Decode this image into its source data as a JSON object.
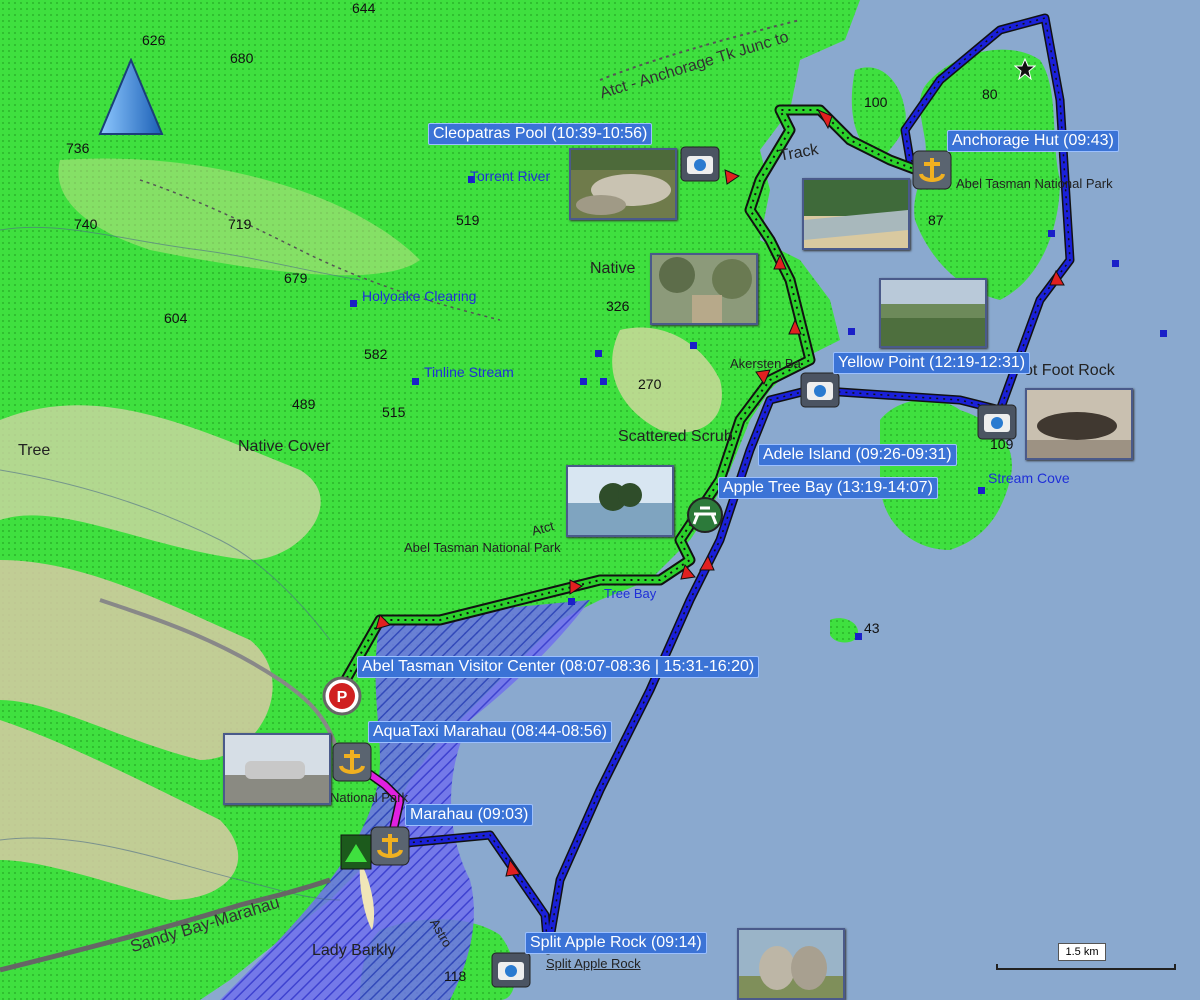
{
  "map": {
    "scale_label": "1.5 km",
    "colors": {
      "sea": "#8aa9cf",
      "land_green": "#3fe03f",
      "land_tan": "#d9d3a0",
      "route_walk": "#2bd12b",
      "route_boat": "#1a20d8",
      "route_taxi": "#e020e0",
      "label_bg": "#3b73d6"
    }
  },
  "waypoints": [
    {
      "name": "Cleopatras Pool (10:39-10:56)",
      "icon": "camera-icon"
    },
    {
      "name": "Anchorage Hut (09:43)",
      "icon": "anchor-icon"
    },
    {
      "name": "Yellow Point (12:19-12:31)",
      "icon": "camera-icon"
    },
    {
      "name": "Adele Island (09:26-09:31)",
      "icon": "camera-icon"
    },
    {
      "name": "Apple Tree Bay (13:19-14:07)",
      "icon": "picnic-icon"
    },
    {
      "name": "Abel Tasman Visitor Center (08:07-08:36 | 15:31-16:20)",
      "icon": "parking-icon"
    },
    {
      "name": "AquaTaxi Marahau (08:44-08:56)",
      "icon": "anchor-icon"
    },
    {
      "name": "Marahau (09:03)",
      "icon": "anchor-icon"
    },
    {
      "name": "Split Apple Rock (09:14)",
      "icon": "camera-icon"
    }
  ],
  "place_labels": {
    "atct_anchorage": "Atct - Anchorage Tk Junc to",
    "torrent_river": "Torrent River",
    "native_top": "Native",
    "holyoake": "Holyoake Clearing",
    "tinline": "Tinline Stream",
    "native_cover": "Native Cover",
    "tree": "Tree",
    "scattered_scrub": "Scattered Scrub",
    "abel_tasman_np_mid": "Abel Tasman National Park",
    "abel_tasman_np_top": "Abel Tasman National Park",
    "atct_mid": "Atct",
    "track_frag": "Track",
    "akers": "Akersten Ba",
    "foot_rock": "ot Foot Rock",
    "stream_cove": "Stream Cove",
    "tree_bay": "Tree Bay",
    "national_park_low": "National Park",
    "sandy_bay": "Sandy Bay-Marahau",
    "lady_barkly": "Lady Barkly",
    "split_apple_small": "Split Apple Rock",
    "astro": "Astro"
  },
  "elevations": {
    "e626": "626",
    "e680": "680",
    "e736": "736",
    "e740": "740",
    "e719": "719",
    "e679": "679",
    "e604": "604",
    "e582": "582",
    "e489": "489",
    "e515": "515",
    "e519": "519",
    "e326": "326",
    "e270": "270",
    "e100": "100",
    "e80": "80",
    "e87": "87",
    "e109": "109",
    "e43": "43",
    "e644": "644",
    "e118": "118"
  }
}
